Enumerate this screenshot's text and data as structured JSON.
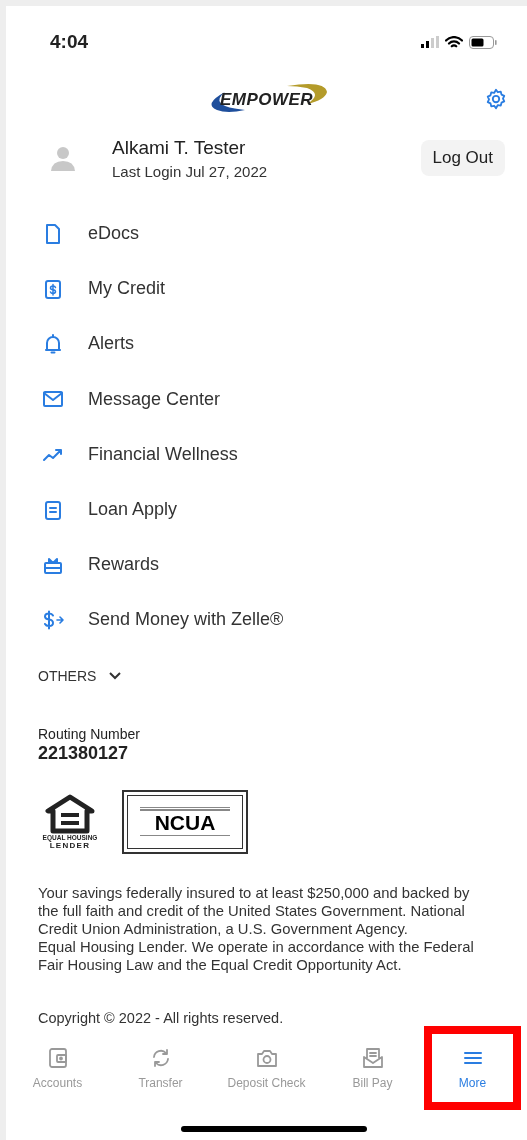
{
  "status_bar": {
    "time": "4:04"
  },
  "header": {
    "logo_text": "EMPOWER"
  },
  "profile": {
    "name": "Alkami T. Tester",
    "last_login": "Last Login Jul 27, 2022",
    "logout_label": "Log Out"
  },
  "menu_items": [
    {
      "label": "eDocs",
      "kind": "document"
    },
    {
      "label": "My Credit",
      "kind": "credit"
    },
    {
      "label": "Alerts",
      "kind": "bell"
    },
    {
      "label": "Message Center",
      "kind": "envelope"
    },
    {
      "label": "Financial Wellness",
      "kind": "trend"
    },
    {
      "label": "Loan Apply",
      "kind": "clipboard"
    },
    {
      "label": "Rewards",
      "kind": "gift"
    },
    {
      "label": "Send Money with Zelle®",
      "kind": "send"
    }
  ],
  "others": {
    "label": "OTHERS",
    "expanded": false
  },
  "routing": {
    "label": "Routing Number",
    "value": "221380127"
  },
  "equal_housing_logo": {
    "line1": "EQUAL HOUSING",
    "line2": "LENDER"
  },
  "ncua_logo": {
    "text": "NCUA"
  },
  "disclaimer": [
    "Your savings federally insured to at least $250,000 and backed by the full faith and credit of the United States Government. National Credit Union Administration, a U.S. Government Agency.",
    "Equal Housing Lender. We operate in accordance with the Federal Fair Housing Law and the Equal Credit Opportunity Act."
  ],
  "copyright": "Copyright © 2022 - All rights reserved.",
  "tab_bar": [
    {
      "label": "Accounts",
      "kind": "wallet",
      "selected": false,
      "highlighted": false
    },
    {
      "label": "Transfer",
      "kind": "transfer",
      "selected": false,
      "highlighted": false
    },
    {
      "label": "Deposit Check",
      "kind": "camera",
      "selected": false,
      "highlighted": false
    },
    {
      "label": "Bill Pay",
      "kind": "bill",
      "selected": false,
      "highlighted": false
    },
    {
      "label": "More",
      "kind": "menu",
      "selected": true,
      "highlighted": true
    }
  ]
}
